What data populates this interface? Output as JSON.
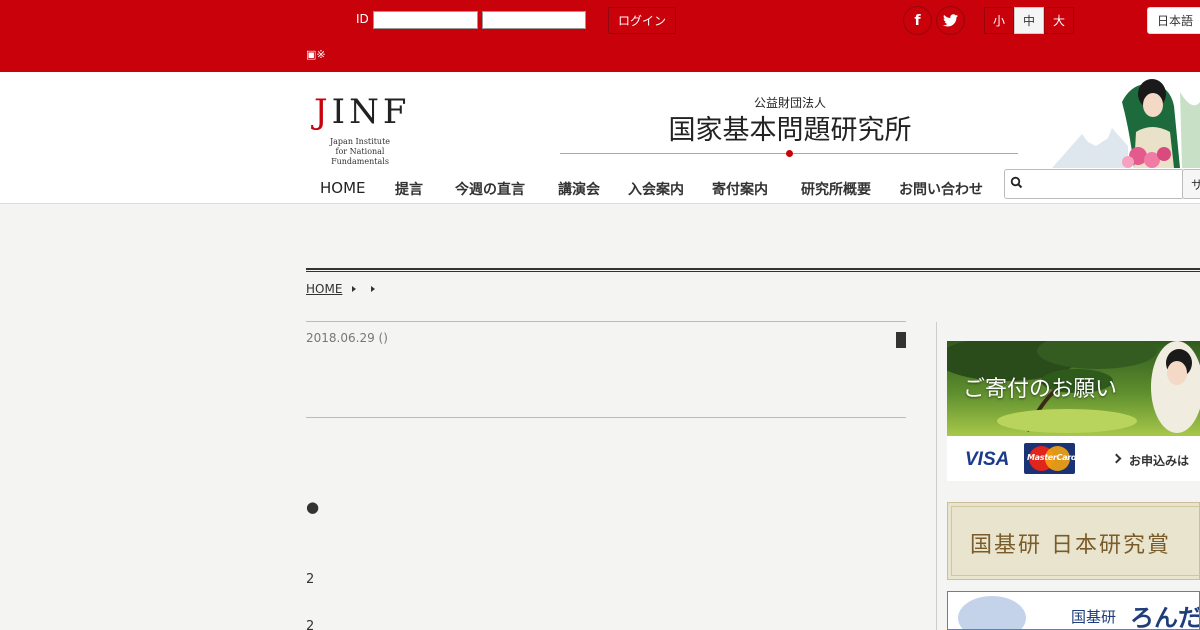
{
  "topbar": {
    "id_label": "ID",
    "login_button": "ログイン",
    "note": "▣※",
    "social": [
      {
        "icon": "facebook-icon",
        "glyph": "f"
      },
      {
        "icon": "twitter-icon"
      }
    ],
    "font_sizes": [
      {
        "label": "小",
        "active": false
      },
      {
        "label": "中",
        "active": true
      },
      {
        "label": "大",
        "active": false
      }
    ],
    "language": "日本語",
    "colors": {
      "brand_red": "#c8010b"
    }
  },
  "header": {
    "logo": {
      "j": "J",
      "rest": "INF",
      "sub_line1": "Japan Institute",
      "sub_line2": "for National Fundamentals"
    },
    "org_small": "公益財団法人",
    "org_title": "国家基本問題研究所",
    "nav": [
      "HOME",
      "提言",
      "今週の直言",
      "講演会",
      "入会案内",
      "寄付案内",
      "研究所概要",
      "お問い合わせ"
    ],
    "search": {
      "placeholder": "",
      "button": "サ"
    }
  },
  "breadcrumb": {
    "home": "HOME"
  },
  "article": {
    "date": "2018.06.29 ()",
    "bullet": "●",
    "numbers": [
      "2",
      "2"
    ]
  },
  "sidebar": {
    "donate": {
      "title": "ご寄付のお願い",
      "visa": "VISA",
      "mastercard": "MasterCard",
      "apply": "お申込みは"
    },
    "prize": {
      "title": "国基研 日本研究賞"
    },
    "ronda": {
      "prefix": "国基研",
      "title": "ろんだ"
    }
  }
}
